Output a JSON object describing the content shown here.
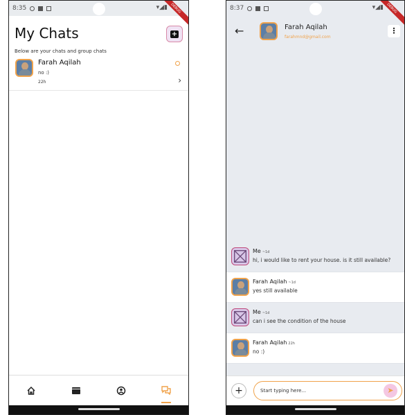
{
  "status_bar_left": {
    "time": "8:35"
  },
  "status_bar_right": {
    "time": "8:37"
  },
  "debug_ribbon": "DEBUG",
  "chats_screen": {
    "title": "My Chats",
    "subtitle": "Below are your chats and group chats",
    "new_chat_icon": "add-chat-icon",
    "chats": [
      {
        "name": "Farah Aqilah",
        "last_message": "no :)",
        "time": "22h",
        "unread": true
      }
    ],
    "nav": [
      {
        "icon": "home-icon",
        "active": false
      },
      {
        "icon": "listings-icon",
        "active": false
      },
      {
        "icon": "profile-icon",
        "active": false
      },
      {
        "icon": "chat-icon",
        "active": true
      }
    ]
  },
  "conversation_screen": {
    "contact_name": "Farah Aqilah",
    "contact_email": "farahmnd@gmail.com",
    "messages": [
      {
        "sender": "Me",
        "ago": "~1d",
        "text": "hi, i would like to rent your house. is it still available?",
        "mine": true
      },
      {
        "sender": "Farah Aqilah",
        "ago": "~1d",
        "text": "yes still available",
        "mine": false
      },
      {
        "sender": "Me",
        "ago": "~1d",
        "text": "can i see the condition of the house",
        "mine": true
      },
      {
        "sender": "Farah Aqilah",
        "ago": "22h",
        "text": "no :)",
        "mine": false
      }
    ],
    "input_placeholder": "Start typing here...",
    "accent_color": "#f0a24a"
  }
}
